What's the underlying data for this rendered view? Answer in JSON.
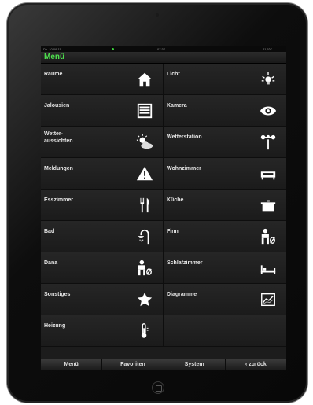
{
  "status": {
    "date": "Do. 10.09.11",
    "time": "07:37",
    "temps": "21,5°C",
    "icons": [
      "camera-icon",
      "dot-icon"
    ]
  },
  "title": "Menü",
  "tiles": [
    {
      "label": "Räume",
      "icon": "house-icon"
    },
    {
      "label": "Licht",
      "icon": "light-bulb-icon"
    },
    {
      "label": "Jalousien",
      "icon": "blinds-icon"
    },
    {
      "label": "Kamera",
      "icon": "eye-icon"
    },
    {
      "label": "Wetter-\naussichten",
      "icon": "weather-icon"
    },
    {
      "label": "Wetterstation",
      "icon": "weather-station-icon"
    },
    {
      "label": "Meldungen",
      "icon": "warning-icon"
    },
    {
      "label": "Wohnzimmer",
      "icon": "sofa-icon"
    },
    {
      "label": "Esszimmer",
      "icon": "cutlery-icon"
    },
    {
      "label": "Küche",
      "icon": "pot-icon"
    },
    {
      "label": "Bad",
      "icon": "shower-icon"
    },
    {
      "label": "Finn",
      "icon": "child-icon"
    },
    {
      "label": "Dana",
      "icon": "child-icon"
    },
    {
      "label": "Schlafzimmer",
      "icon": "bed-icon"
    },
    {
      "label": "Sonstiges",
      "icon": "star-icon"
    },
    {
      "label": "Diagramme",
      "icon": "chart-icon"
    },
    {
      "label": "Heizung",
      "icon": "thermometer-icon"
    },
    {
      "label": "",
      "icon": ""
    }
  ],
  "tabs": [
    "Menü",
    "Favoriten",
    "System",
    "‹ zurück"
  ]
}
